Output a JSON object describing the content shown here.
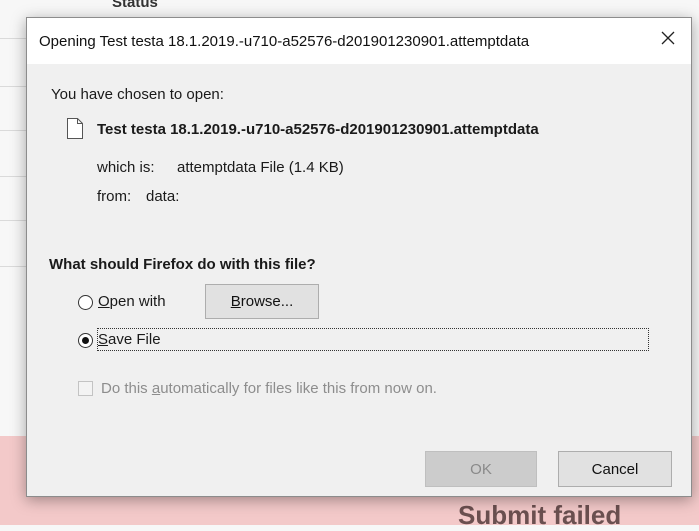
{
  "background": {
    "status_heading": "Status",
    "submit_text": "Submit failed"
  },
  "dialog": {
    "title": "Opening Test testa 18.1.2019.-u710-a52576-d201901230901.attemptdata",
    "close_glyph": "✕",
    "chosen_label": "You have chosen to open:",
    "filename": "Test testa 18.1.2019.-u710-a52576-d201901230901.attemptdata",
    "which_is_label": "which is:",
    "which_is_value": "attemptdata File (1.4 KB)",
    "from_label": "from:",
    "from_value": "data:",
    "question": "What should Firefox do with this file?",
    "open_with": {
      "accesskey": "O",
      "rest": "pen with",
      "selected": false
    },
    "browse_button": {
      "accesskey": "B",
      "rest": "rowse..."
    },
    "save_file": {
      "accesskey": "S",
      "rest": "ave File",
      "selected": true
    },
    "auto_checkbox": {
      "prefix": "Do this ",
      "accesskey": "a",
      "suffix": "utomatically for files like this from now on.",
      "checked": false,
      "enabled": false
    },
    "ok_button": "OK",
    "cancel_button": "Cancel"
  }
}
